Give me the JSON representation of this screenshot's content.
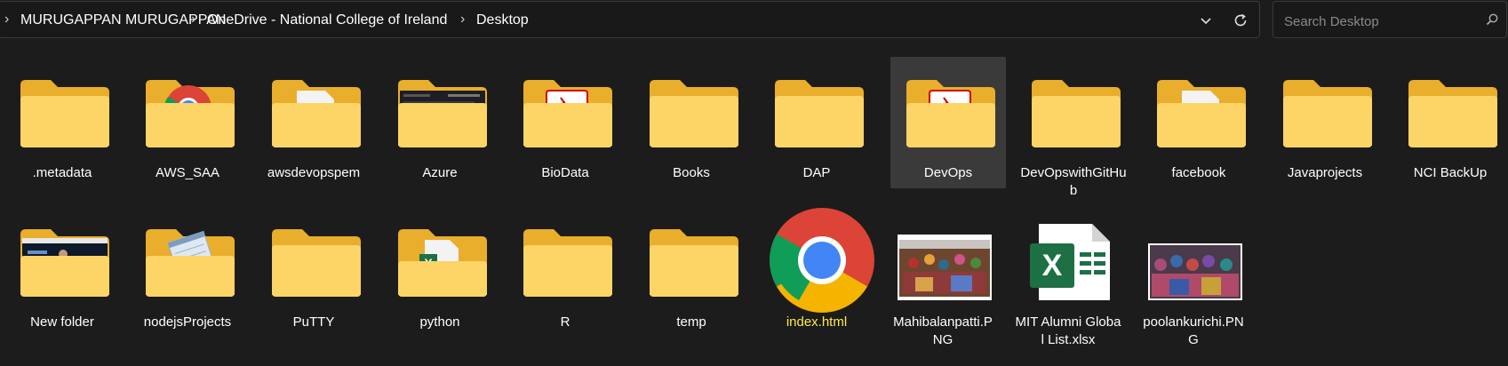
{
  "address": {
    "crumbs": [
      "MURUGAPPAN MURUGAPPAN",
      "OneDrive - National College of Ireland",
      "Desktop"
    ],
    "sep": "›"
  },
  "search": {
    "placeholder": "Search Desktop"
  },
  "row1": [
    {
      "label": ".metadata",
      "icon": "folder-icon"
    },
    {
      "label": "AWS_SAA",
      "icon": "folder-chrome-preview-icon"
    },
    {
      "label": "awsdevopspem",
      "icon": "folder-document-preview-icon"
    },
    {
      "label": "Azure",
      "icon": "folder-screenshot-preview-icon"
    },
    {
      "label": "BioData",
      "icon": "folder-pdf-preview-icon"
    },
    {
      "label": "Books",
      "icon": "folder-icon"
    },
    {
      "label": "DAP",
      "icon": "folder-icon"
    },
    {
      "label": "DevOps",
      "icon": "folder-pdf-preview-icon",
      "selected": true
    },
    {
      "label": "DevOpswithGitHub",
      "icon": "folder-icon"
    },
    {
      "label": "facebook",
      "icon": "folder-document-preview-icon"
    },
    {
      "label": "Javaprojects",
      "icon": "folder-icon"
    },
    {
      "label": "NCI BackUp",
      "icon": "folder-icon"
    }
  ],
  "row2": [
    {
      "label": "New folder",
      "icon": "folder-video-preview-icon"
    },
    {
      "label": "nodejsProjects",
      "icon": "folder-notepad-preview-icon"
    },
    {
      "label": "PuTTY",
      "icon": "folder-icon"
    },
    {
      "label": "python",
      "icon": "folder-excel-preview-icon"
    },
    {
      "label": "R",
      "icon": "folder-icon"
    },
    {
      "label": "temp",
      "icon": "folder-icon"
    },
    {
      "label": "index.html",
      "icon": "chrome-icon"
    },
    {
      "label": "Mahibalanpatti.PNG",
      "icon": "image-thumbnail-icon"
    },
    {
      "label": "MIT Alumni Global List.xlsx",
      "icon": "excel-file-icon"
    },
    {
      "label": "poolankurichi.PNG",
      "icon": "image-thumbnail-icon"
    }
  ],
  "colors": {
    "folder_back": "#e9ae2c",
    "folder_front": "#fcd566",
    "text_highlight": "#ffe94a"
  }
}
